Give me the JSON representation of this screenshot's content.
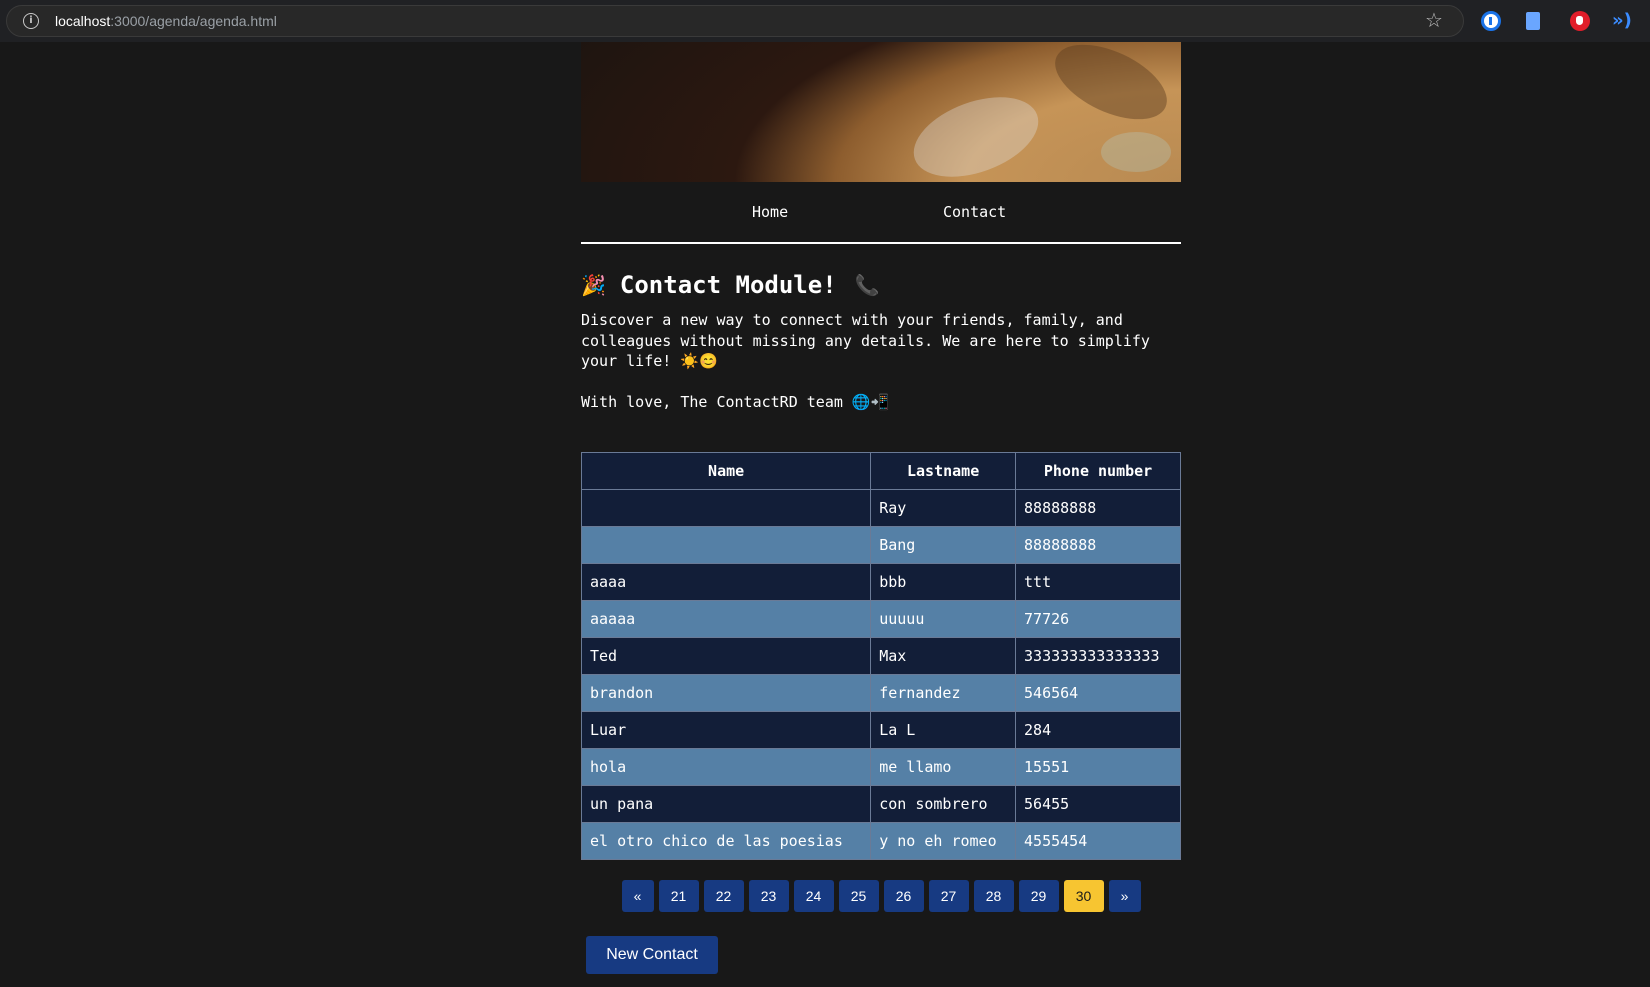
{
  "browser": {
    "url_host": "localhost",
    "url_rest": ":3000/agenda/agenda.html"
  },
  "nav": {
    "home": "Home",
    "contact": "Contact"
  },
  "header": {
    "title": "Contact Module!",
    "left_emoji": "🎉",
    "right_emoji": "📞"
  },
  "intro": {
    "text": "Discover a new way to connect with your friends, family, and colleagues without missing any details. We are here to simplify your life! ☀️😊",
    "signoff": "With love, The ContactRD team 🌐📲"
  },
  "table": {
    "headers": [
      "Name",
      "Lastname",
      "Phone number"
    ],
    "rows": [
      {
        "name": "",
        "lastname": "Ray",
        "phone": "88888888"
      },
      {
        "name": "",
        "lastname": "Bang",
        "phone": "88888888"
      },
      {
        "name": "aaaa",
        "lastname": "bbb",
        "phone": "ttt"
      },
      {
        "name": "aaaaa",
        "lastname": "uuuuu",
        "phone": "77726"
      },
      {
        "name": "Ted",
        "lastname": "Max",
        "phone": "333333333333333"
      },
      {
        "name": "brandon",
        "lastname": "fernandez",
        "phone": "546564"
      },
      {
        "name": "Luar",
        "lastname": "La L",
        "phone": "284"
      },
      {
        "name": "hola",
        "lastname": "me llamo",
        "phone": "15551"
      },
      {
        "name": "un pana",
        "lastname": "con sombrero",
        "phone": "56455"
      },
      {
        "name": "el otro chico de las poesias",
        "lastname": "y no eh romeo",
        "phone": "4555454"
      }
    ]
  },
  "pagination": {
    "prev": "«",
    "next": "»",
    "pages": [
      "21",
      "22",
      "23",
      "24",
      "25",
      "26",
      "27",
      "28",
      "29",
      "30"
    ],
    "current": "30"
  },
  "actions": {
    "new_contact": "New Contact"
  },
  "colors": {
    "background": "#181818",
    "row_dark": "#121e38",
    "row_light": "#5580a6",
    "button": "#173a82",
    "active_page": "#f7c531"
  }
}
